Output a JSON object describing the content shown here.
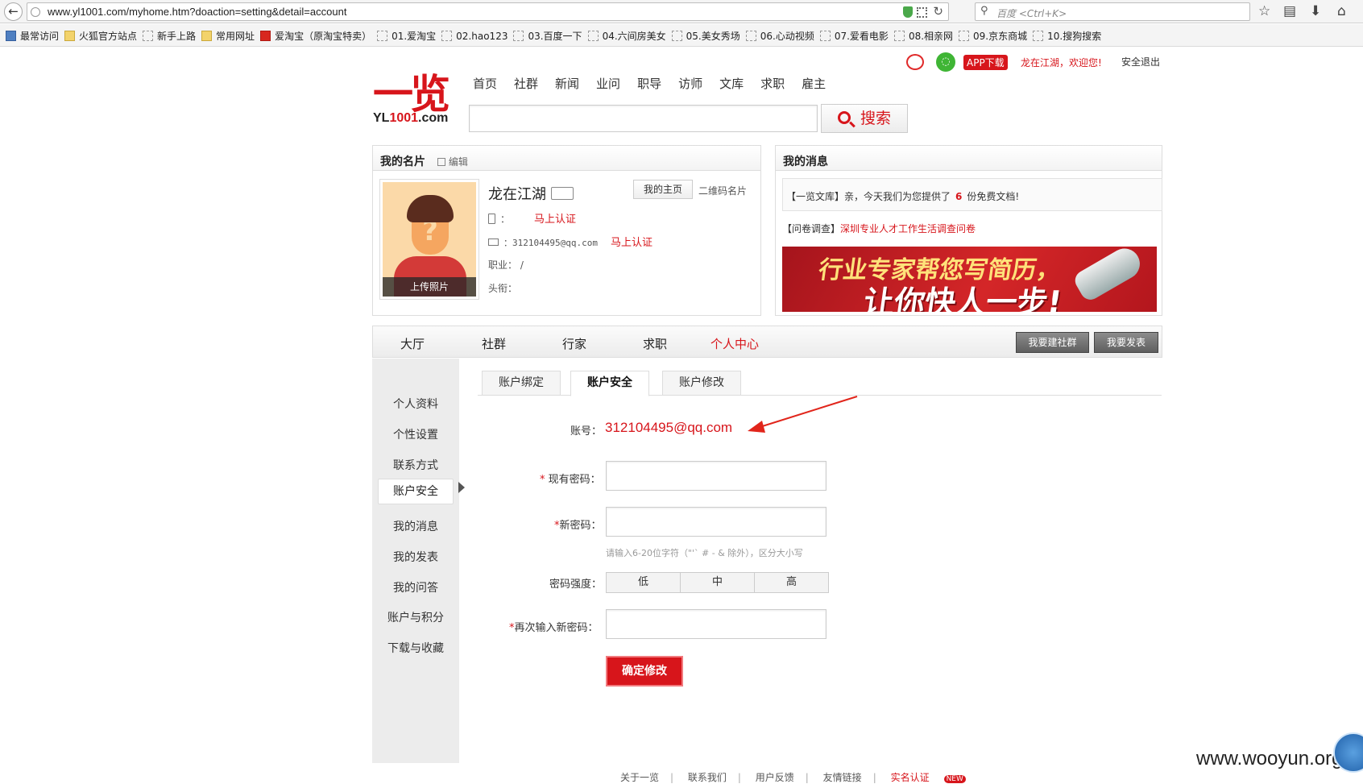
{
  "browser": {
    "url": "www.yl1001.com/myhome.htm?doaction=setting&detail=account",
    "search_placeholder": "百度 <Ctrl+K>",
    "bookmarks": [
      {
        "label": "最常访问",
        "icon": "blue"
      },
      {
        "label": "火狐官方站点",
        "icon": "folder"
      },
      {
        "label": "新手上路",
        "icon": "dashed"
      },
      {
        "label": "常用网址",
        "icon": "folder"
      },
      {
        "label": "爱淘宝（原淘宝特卖）",
        "icon": "red"
      },
      {
        "label": "01.爱淘宝",
        "icon": "dashed"
      },
      {
        "label": "02.hao123",
        "icon": "dashed"
      },
      {
        "label": "03.百度一下",
        "icon": "dashed"
      },
      {
        "label": "04.六间房美女",
        "icon": "dashed"
      },
      {
        "label": "05.美女秀场",
        "icon": "dashed"
      },
      {
        "label": "06.心动视频",
        "icon": "dashed"
      },
      {
        "label": "07.爱看电影",
        "icon": "dashed"
      },
      {
        "label": "08.相亲网",
        "icon": "dashed"
      },
      {
        "label": "09.京东商城",
        "icon": "dashed"
      },
      {
        "label": "10.搜狗搜索",
        "icon": "dashed"
      }
    ]
  },
  "topbar": {
    "app_download": "APP下载",
    "welcome": "龙在江湖，欢迎您!",
    "logout": "安全退出"
  },
  "logo": {
    "mark": "一览",
    "site_prefix": "YL",
    "site_number": "1001",
    "site_suffix": ".com"
  },
  "main_nav": [
    "首页",
    "社群",
    "新闻",
    "业问",
    "职导",
    "访师",
    "文库",
    "求职",
    "雇主"
  ],
  "search": {
    "button_label": "搜索",
    "value": ""
  },
  "card": {
    "title": "我的名片",
    "edit": "编辑",
    "upload_photo": "上传照片",
    "name": "龙在江湖",
    "homepage_button": "我的主页",
    "qr_card": "二维码名片",
    "phone_label": "：",
    "phone_verify": "马上认证",
    "email": "：312104495@qq.com",
    "email_verify": "马上认证",
    "job": "职业：  /",
    "title_label": "头衔："
  },
  "messages": {
    "title": "我的消息",
    "msg1_prefix": "【一览文库】亲，今天我们为您提供了",
    "msg1_count": "6",
    "msg1_suffix": "份免费文档!",
    "msg2_prefix": "【问卷调查】",
    "msg2_link": "深圳专业人才工作生活调查问卷",
    "banner_line1": "行业专家帮您写简历，",
    "banner_line2": "让你快人一步!"
  },
  "section_tabs": [
    {
      "label": "大厅",
      "active": false
    },
    {
      "label": "社群",
      "active": false
    },
    {
      "label": "行家",
      "active": false
    },
    {
      "label": "求职",
      "active": false
    },
    {
      "label": "个人中心",
      "active": true
    }
  ],
  "section_buttons": {
    "create_group": "我要建社群",
    "publish": "我要发表"
  },
  "sidebar": [
    {
      "label": "个人资料",
      "active": false
    },
    {
      "label": "个性设置",
      "active": false
    },
    {
      "label": "联系方式",
      "active": false
    },
    {
      "label": "账户安全",
      "active": true
    },
    {
      "label": "我的消息",
      "active": false
    },
    {
      "label": "我的发表",
      "active": false
    },
    {
      "label": "我的问答",
      "active": false
    },
    {
      "label": "账户与积分",
      "active": false
    },
    {
      "label": "下载与收藏",
      "active": false
    }
  ],
  "subtabs": [
    {
      "label": "账户绑定",
      "active": false
    },
    {
      "label": "账户安全",
      "active": true
    },
    {
      "label": "账户修改",
      "active": false
    }
  ],
  "form": {
    "account_label": "账号：",
    "account_value": "312104495@qq.com",
    "current_pw_label": "现有密码：",
    "new_pw_label": "新密码：",
    "pw_hint": "请输入6-20位字符（\"'` # - & 除外），区分大小写",
    "strength_label": "密码强度：",
    "strength_levels": [
      "低",
      "中",
      "高"
    ],
    "confirm_pw_label": "再次输入新密码：",
    "required_mark": "*",
    "submit": "确定修改"
  },
  "footer": {
    "items": [
      "关于一览",
      "联系我们",
      "用户反馈",
      "友情链接"
    ],
    "realname": "实名认证",
    "new_badge": "NEW"
  },
  "watermark": "www.wooyun.org",
  "colors": {
    "brand_red": "#d7151b",
    "sidebar_bg": "#ececec"
  }
}
